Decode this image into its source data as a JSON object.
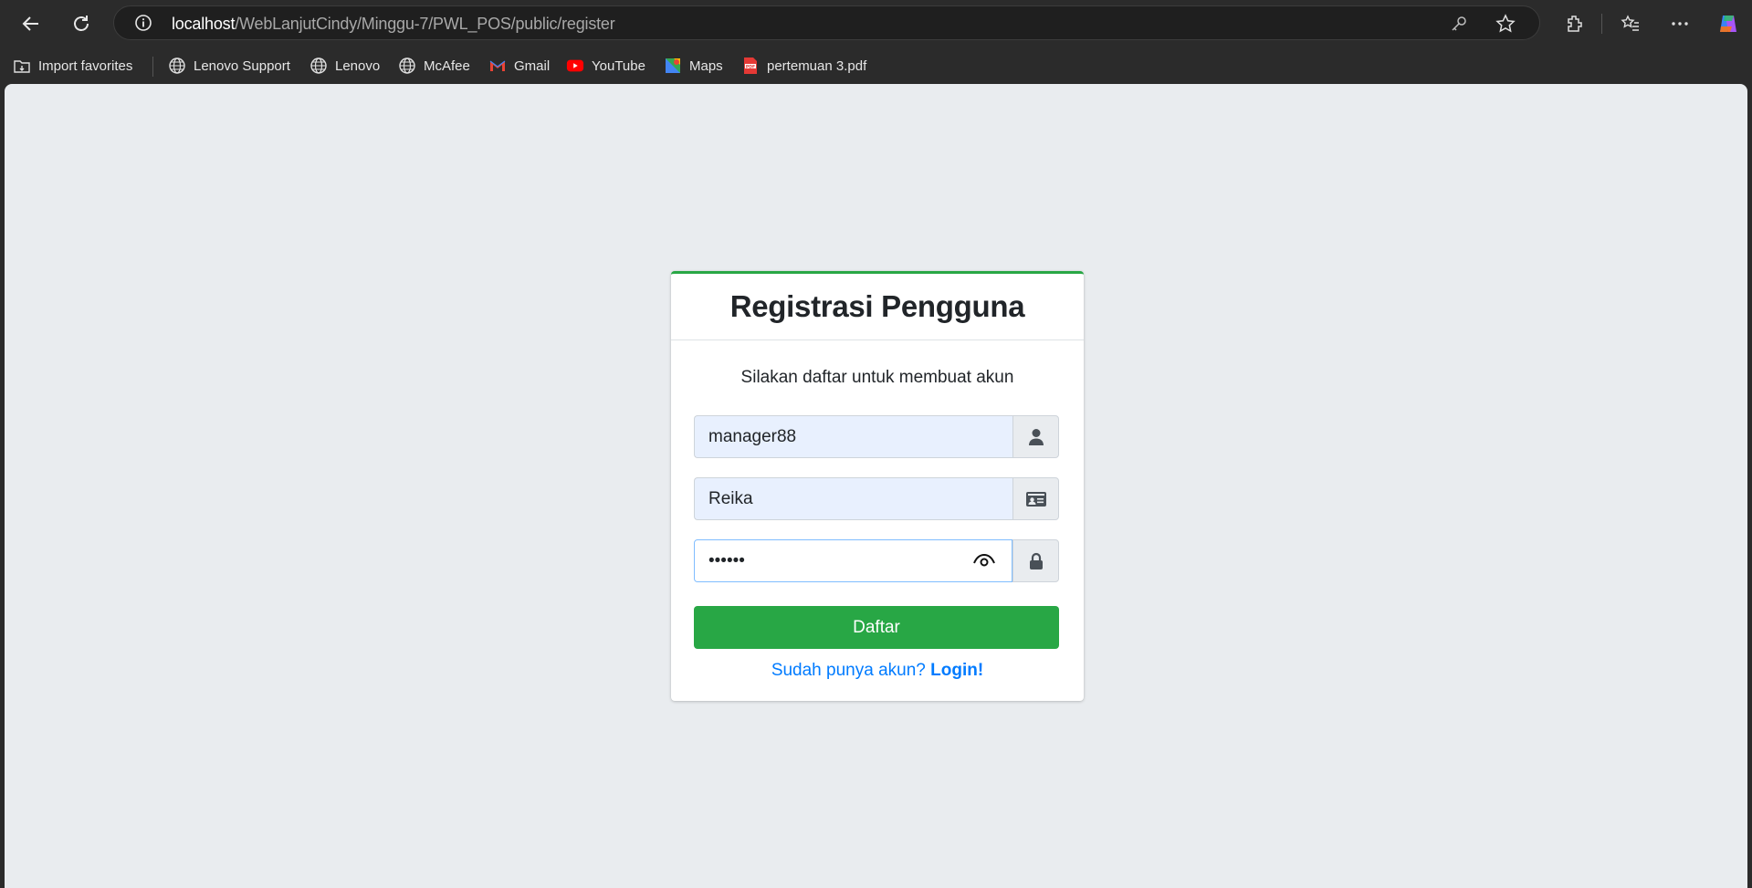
{
  "browser": {
    "url_host": "localhost",
    "url_path": "/WebLanjutCindy/Minggu-7/PWL_POS/public/register",
    "bookmarks": [
      {
        "label": "Import favorites",
        "icon": "import-favorites-icon"
      },
      {
        "label": "Lenovo Support",
        "icon": "globe-icon"
      },
      {
        "label": "Lenovo",
        "icon": "globe-icon"
      },
      {
        "label": "McAfee",
        "icon": "globe-icon"
      },
      {
        "label": "Gmail",
        "icon": "gmail-icon"
      },
      {
        "label": "YouTube",
        "icon": "youtube-icon"
      },
      {
        "label": "Maps",
        "icon": "maps-icon"
      },
      {
        "label": "pertemuan 3.pdf",
        "icon": "pdf-icon"
      }
    ]
  },
  "page": {
    "title": "Registrasi Pengguna",
    "message": "Silakan daftar untuk membuat akun",
    "username": {
      "value": "manager88",
      "icon": "user-icon"
    },
    "name": {
      "value": "Reika",
      "icon": "id-card-icon"
    },
    "password": {
      "value": "••••••",
      "icon": "lock-icon"
    },
    "submit_label": "Daftar",
    "login_prompt": "Sudah punya akun?",
    "login_link": "Login!"
  },
  "colors": {
    "accent": "#28a745",
    "link": "#007bff",
    "page_bg": "#e9ecef"
  }
}
